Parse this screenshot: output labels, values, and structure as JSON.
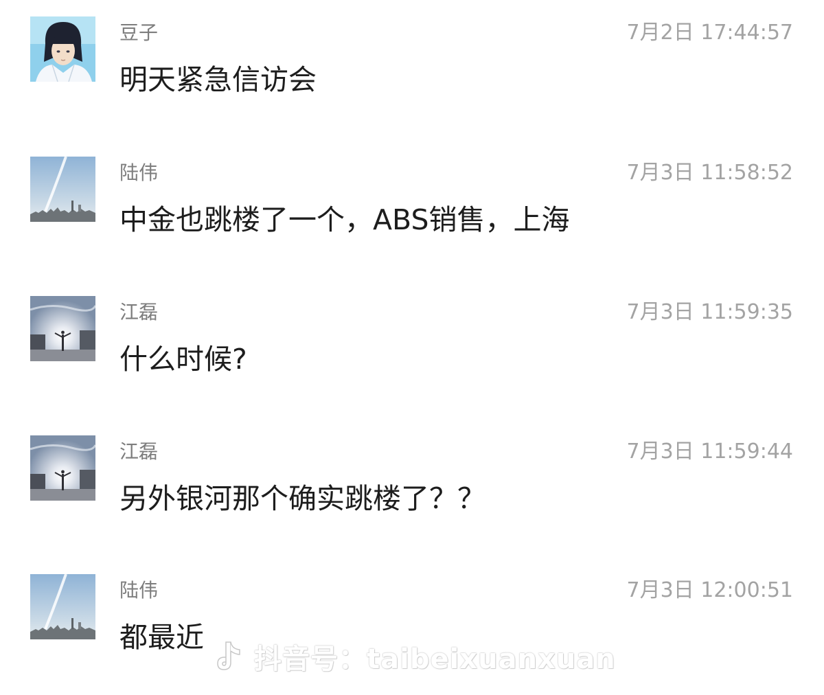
{
  "messages": [
    {
      "sender": "豆子",
      "time": "7月2日 17:44:57",
      "content": "明天紧急信访会",
      "avatar": "anime-girl-avatar-icon"
    },
    {
      "sender": "陆伟",
      "time": "7月3日 11:58:52",
      "content": "中金也跳楼了一个，ABS销售，上海",
      "avatar": "sky-contrail-avatar-icon"
    },
    {
      "sender": "江磊",
      "time": "7月3日 11:59:35",
      "content": "什么时候?",
      "avatar": "sunset-person-avatar-icon"
    },
    {
      "sender": "江磊",
      "time": "7月3日 11:59:44",
      "content": "另外银河那个确实跳楼了？？",
      "avatar": "sunset-person-avatar-icon"
    },
    {
      "sender": "陆伟",
      "time": "7月3日 12:00:51",
      "content": "都最近",
      "avatar": "sky-contrail-avatar-icon"
    }
  ],
  "watermark": {
    "icon": "douyin-logo-icon",
    "text": "抖音号：taibeixuanxuan"
  },
  "colors": {
    "background": "#ffffff",
    "sender": "#7d7d7d",
    "time": "#a3a3a3",
    "content": "#1d1d1d"
  }
}
